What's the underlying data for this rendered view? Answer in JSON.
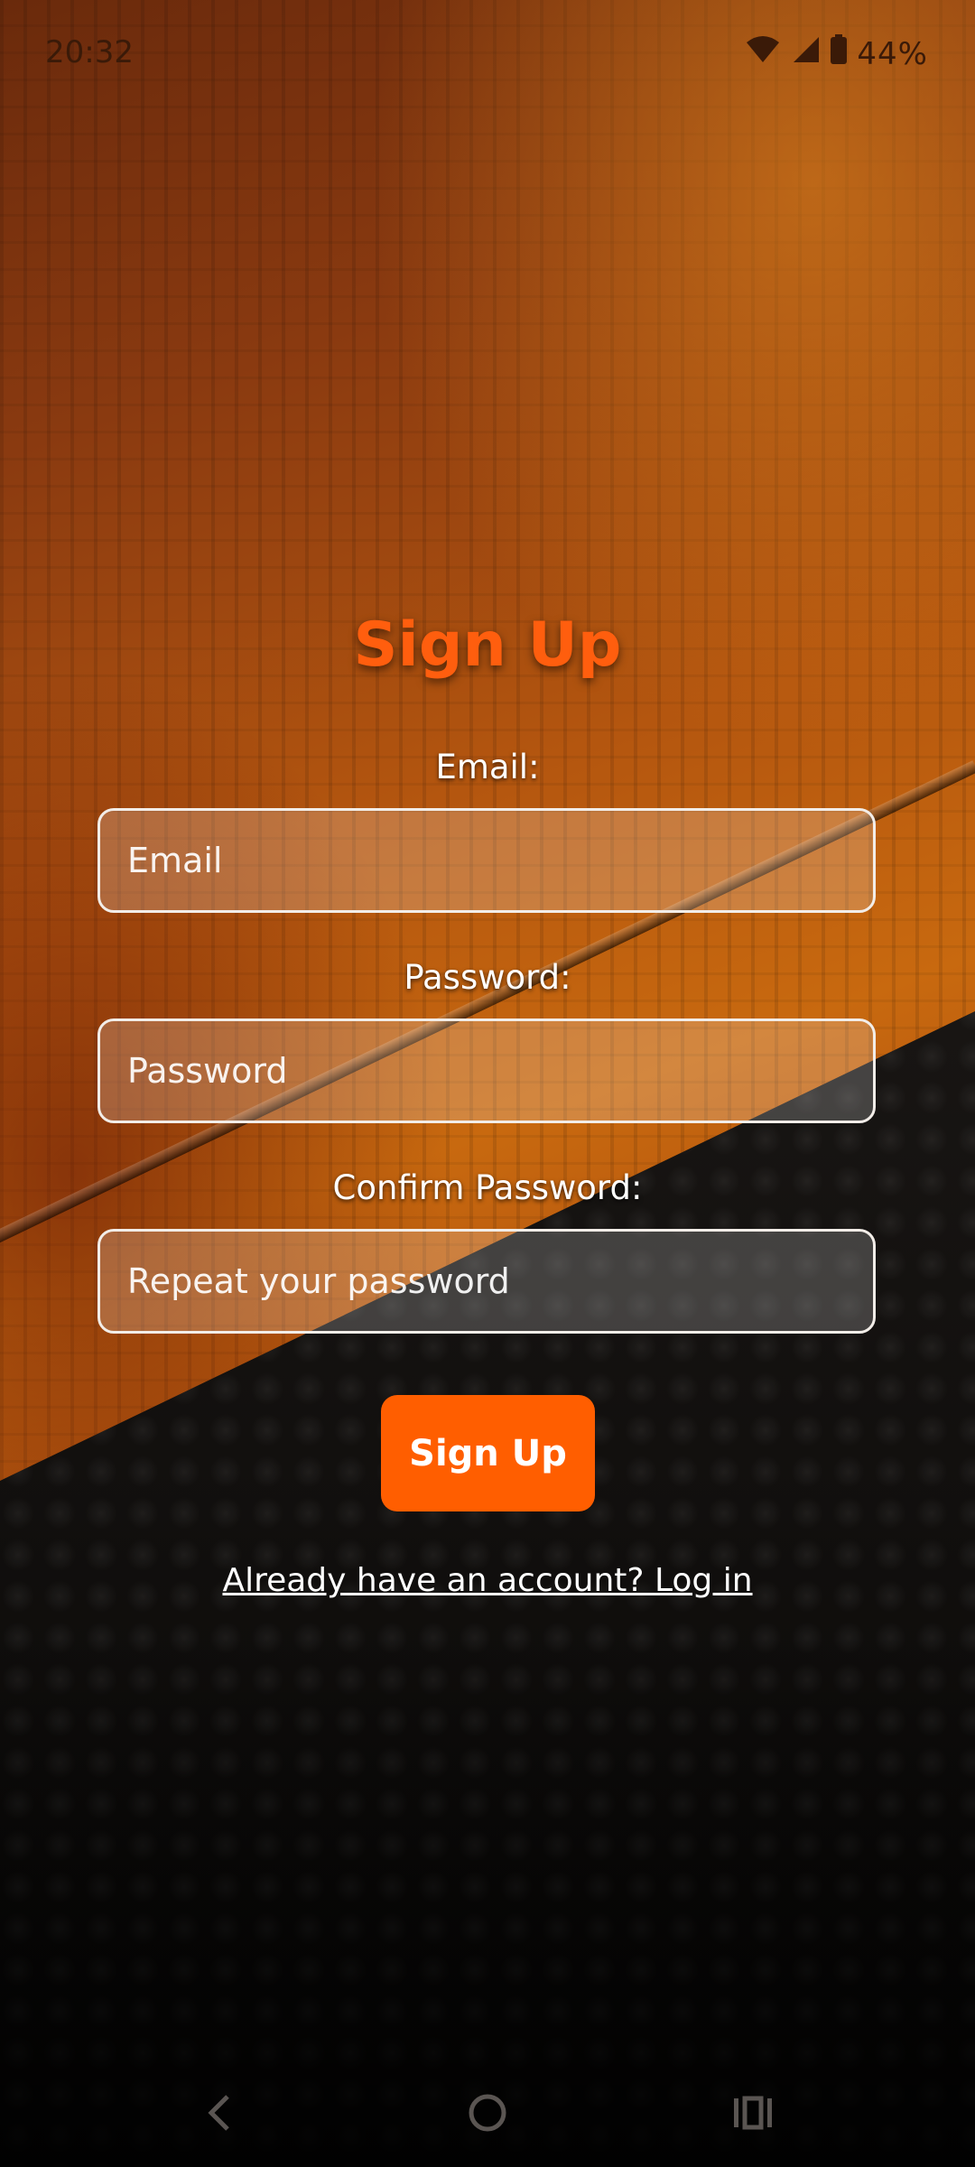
{
  "status_bar": {
    "time": "20:32",
    "battery": "44%",
    "icons": [
      "wifi-icon",
      "cell-signal-icon",
      "battery-icon"
    ]
  },
  "form": {
    "title": "Sign Up",
    "email_label": "Email:",
    "email_placeholder": "Email",
    "email_value": "",
    "password_label": "Password:",
    "password_placeholder": "Password",
    "password_value": "",
    "confirm_label": "Confirm Password:",
    "confirm_placeholder": "Repeat your password",
    "confirm_value": "",
    "submit_label": "Sign Up",
    "login_link": "Already have an account? Log in"
  },
  "nav_bar": {
    "icons": [
      "back-icon",
      "home-icon",
      "recents-icon"
    ]
  },
  "colors": {
    "accent": "#ff5e00",
    "title": "#ff5e0e"
  }
}
